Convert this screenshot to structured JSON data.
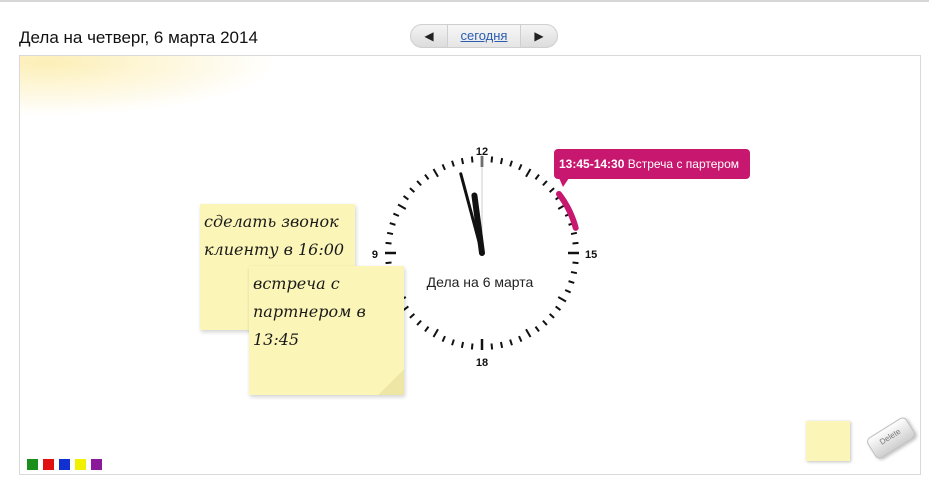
{
  "header": {
    "title": "Дела на четверг, 6 марта 2014",
    "nav": {
      "prev_icon": "◀",
      "today_label": "сегодня",
      "next_icon": "▶"
    }
  },
  "clock": {
    "caption": "Дела на 6 марта",
    "labels": {
      "top": "12",
      "right": "15",
      "bottom": "18",
      "left": "9"
    },
    "time": "13:45"
  },
  "event": {
    "time_range": "13:45-14:30",
    "title": "Встреча с партером",
    "color": "#c8176e"
  },
  "notes": [
    {
      "lines": [
        "сделать звонок",
        "клиенту в 16:00"
      ]
    },
    {
      "lines": [
        "встреча с",
        "партнером в",
        "13:45"
      ]
    }
  ],
  "palette": [
    "#1a8f1a",
    "#e01010",
    "#1030d0",
    "#f0f000",
    "#8a1a9a"
  ],
  "tools": {
    "new_note_color": "#fbf5b8",
    "delete_label": "Delete"
  }
}
